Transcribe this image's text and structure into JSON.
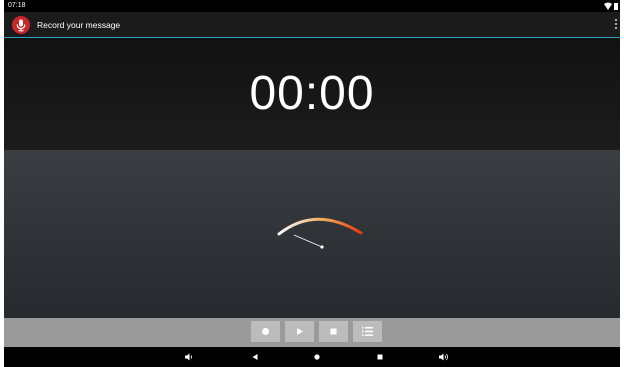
{
  "status_bar": {
    "time": "07:18",
    "icons": [
      "wifi-icon",
      "battery-icon"
    ]
  },
  "app_bar": {
    "app_icon": "microphone-icon",
    "title": "Record your message",
    "menu_icon": "overflow-menu-icon"
  },
  "timer": {
    "display": "00:00"
  },
  "level_meter": {
    "level": 0
  },
  "controls": {
    "buttons": [
      "record-icon",
      "play-icon",
      "stop-icon",
      "list-icon"
    ]
  },
  "nav_bar": {
    "buttons": [
      "volume-down-icon",
      "back-icon",
      "home-icon",
      "recents-icon",
      "volume-up-icon"
    ]
  },
  "colors": {
    "accent": "#2ba3c0",
    "app_icon_bg": "#c62828",
    "meter_start": "#ffffff",
    "meter_mid": "#f0a050",
    "meter_end": "#e63a12"
  }
}
